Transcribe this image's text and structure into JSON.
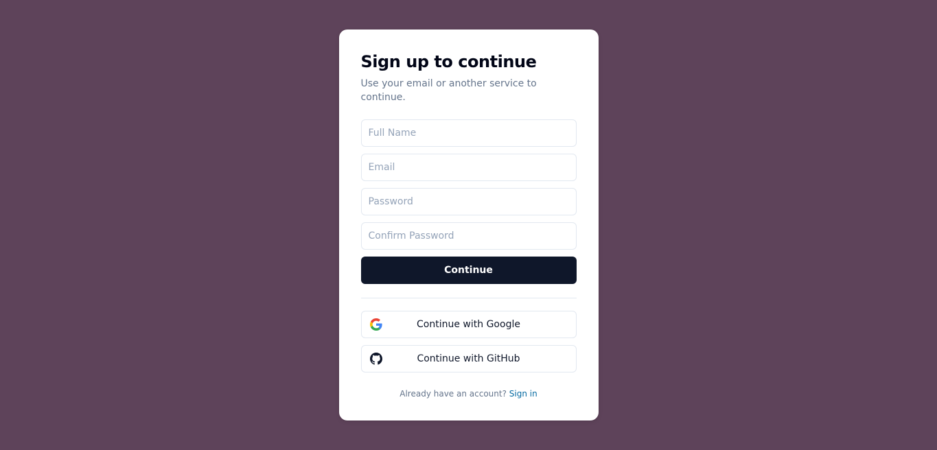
{
  "header": {
    "title": "Sign up to continue",
    "subtitle": "Use your email or another service to continue."
  },
  "form": {
    "full_name_placeholder": "Full Name",
    "email_placeholder": "Email",
    "password_placeholder": "Password",
    "confirm_password_placeholder": "Confirm Password",
    "submit_label": "Continue"
  },
  "oauth": {
    "google_label": "Continue with Google",
    "github_label": "Continue with GitHub"
  },
  "footer": {
    "prompt": "Already have an account? ",
    "link_label": "Sign in"
  }
}
